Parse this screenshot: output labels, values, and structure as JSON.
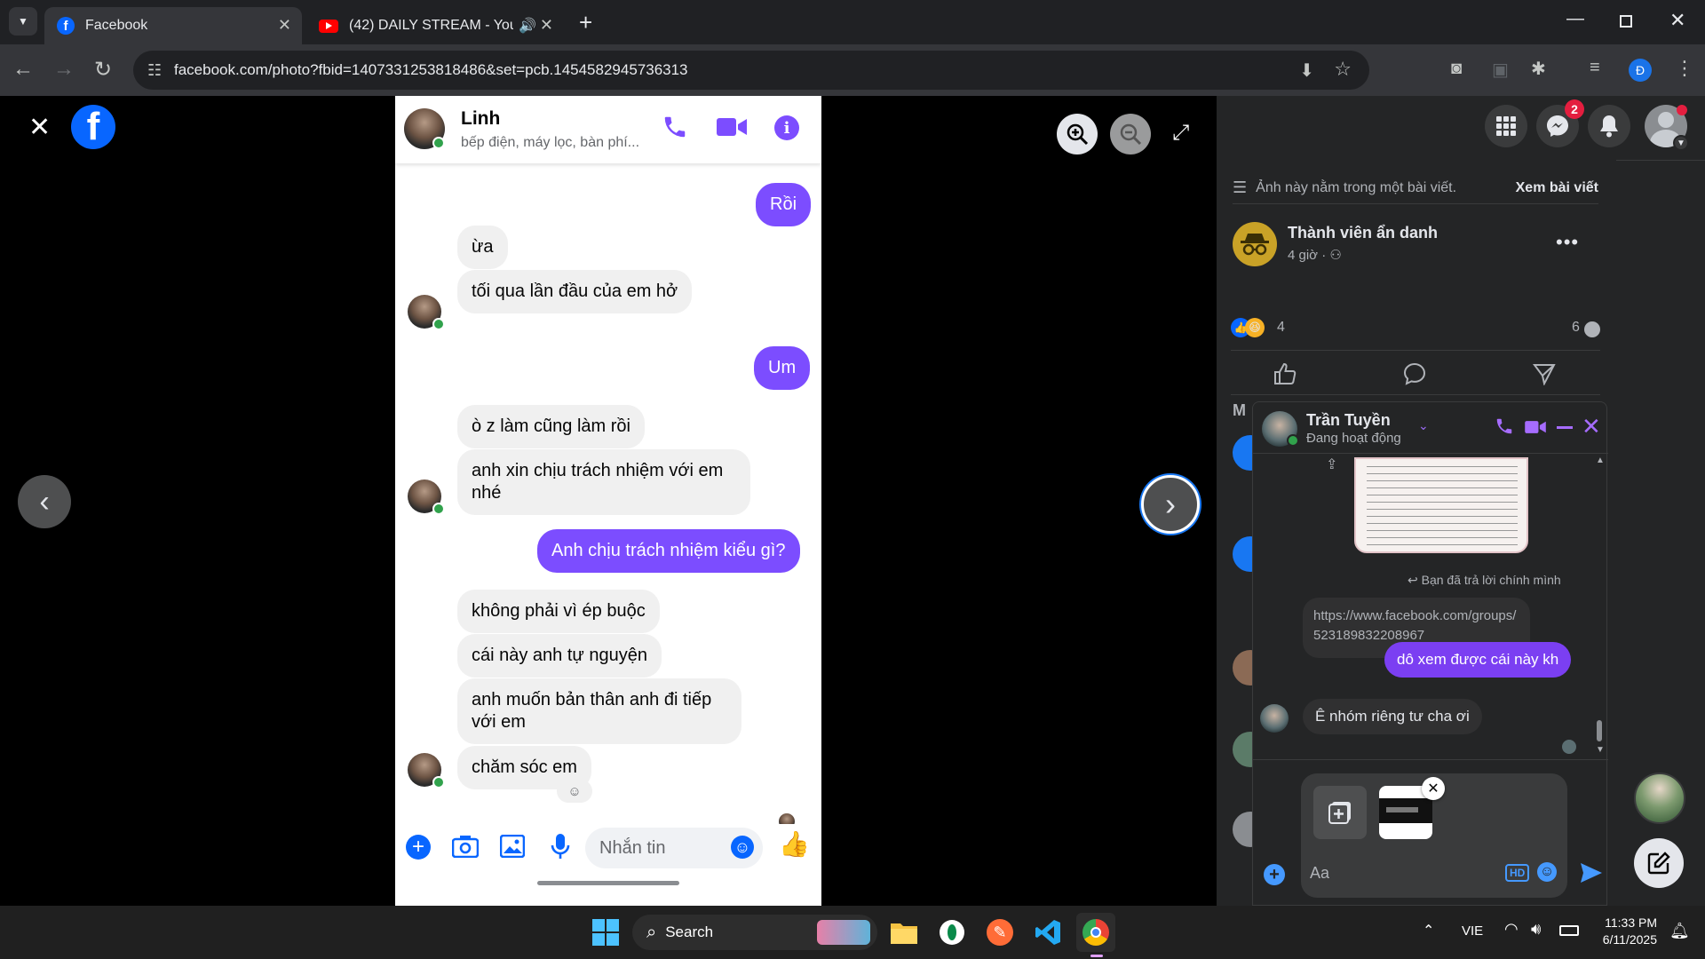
{
  "browser": {
    "tabs": [
      {
        "title": "Facebook",
        "active": true
      },
      {
        "title": "(42) DAILY STREAM - YouTu",
        "active": false
      }
    ],
    "url": "facebook.com/photo?fbid=1407331253818486&set=pcb.1454582945736313",
    "profile_letter": "Đ"
  },
  "chat_screenshot": {
    "contact_name": "Linh",
    "contact_subtitle": "bếp điện, máy lọc, bàn phí...",
    "messages": [
      {
        "dir": "out",
        "text": "Rồi"
      },
      {
        "dir": "in",
        "text": "ừa"
      },
      {
        "dir": "in",
        "text": "tối qua lần đầu của em hở"
      },
      {
        "dir": "out",
        "text": "Um"
      },
      {
        "dir": "in",
        "text": "ò z làm cũng làm rồi"
      },
      {
        "dir": "in",
        "text": "anh xin chịu trách nhiệm với em nhé"
      },
      {
        "dir": "out",
        "text": "Anh chịu trách nhiệm kiểu gì?"
      },
      {
        "dir": "in",
        "text": "không phải vì ép buộc"
      },
      {
        "dir": "in",
        "text": "cái này anh tự nguyện"
      },
      {
        "dir": "in",
        "text": "anh muốn bản thân anh đi tiếp với em"
      },
      {
        "dir": "in",
        "text": "chăm sóc em"
      }
    ],
    "input_placeholder": "Nhắn tin"
  },
  "post_panel": {
    "notice": "Ảnh này nằm trong một bài viết.",
    "view_post_link": "Xem bài viết",
    "author": "Thành viên ẩn danh",
    "time": "4 giờ ·",
    "reaction_count": "4",
    "comment_count": "6",
    "notification_badge": "2",
    "section_letter": "M"
  },
  "chat_window": {
    "contact_name": "Trần Tuyền",
    "status": "Đang hoạt động",
    "reply_note": "Bạn đã trả lời chính mình",
    "link_text": "https://www.facebook.com/groups/523189832208967",
    "out_message": "dô xem được cái này kh",
    "in_message": "Ê nhóm riêng tư cha ơi",
    "input_placeholder": "Aa",
    "hd_label": "HD"
  },
  "taskbar": {
    "search_label": "Search",
    "language": "VIE",
    "time": "11:33 PM",
    "date": "6/11/2025"
  },
  "colors": {
    "messenger_purple": "#7c4dff",
    "fb_blue": "#0866ff",
    "chat_out_purple": "#7b3ff2"
  }
}
